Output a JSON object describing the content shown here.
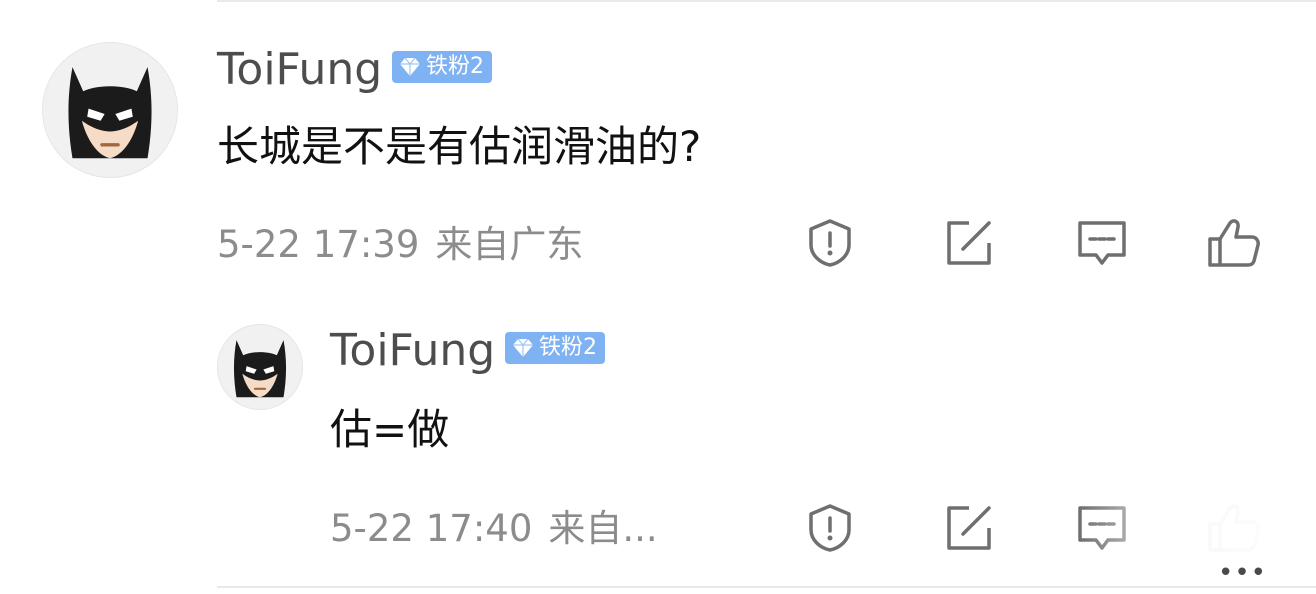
{
  "colors": {
    "username": "#4d4d4d",
    "body_text": "#111111",
    "meta_text": "#8c8c8c",
    "badge_bg": "#7fb2f2",
    "icon_stroke": "#6f6f6f"
  },
  "comment": {
    "username": "ToiFung",
    "badge": "铁粉2",
    "text": "长城是不是有估润滑油的?",
    "date": "5-22 17:39",
    "location": "来自广东",
    "avatar_icon": "batman-avatar-icon"
  },
  "reply": {
    "username": "ToiFung",
    "badge": "铁粉2",
    "text": "估=做",
    "date": "5-22 17:40",
    "location": "来自...",
    "avatar_icon": "batman-avatar-icon"
  },
  "actions": [
    {
      "name": "report",
      "icon": "shield-alert-icon"
    },
    {
      "name": "share",
      "icon": "share-external-icon"
    },
    {
      "name": "comment",
      "icon": "comment-bubble-icon"
    },
    {
      "name": "like",
      "icon": "thumbs-up-icon"
    }
  ],
  "overlay": {
    "more": "•••"
  }
}
